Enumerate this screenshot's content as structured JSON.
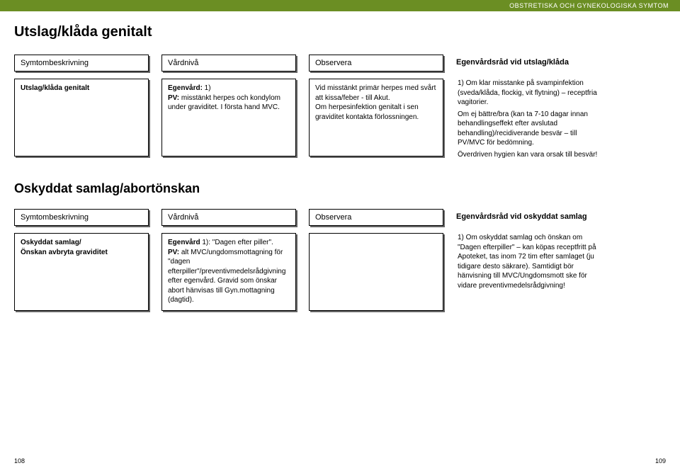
{
  "banner": "OBSTRETISKA OCH GYNEKOLOGISKA SYMTOM",
  "mainTitle": "Utslag/klåda genitalt",
  "section1": {
    "headers": {
      "c1": "Symtombeskrivning",
      "c2": "Vårdnivå",
      "c3": "Observera",
      "c4": "Egenvårdsråd vid utslag/klåda"
    },
    "row": {
      "c1_bold": "Utslag/klåda genitalt",
      "c2_b1": "Egenvård:",
      "c2_t1": " 1)",
      "c2_b2": "PV:",
      "c2_t2": " misstänkt herpes och kondylom under graviditet. I första hand MVC.",
      "c3": "Vid misstänkt primär herpes med svårt att kissa/feber - till Akut.\nOm herpesinfektion genitalt i sen graviditet kontakta förlossningen.",
      "c4_p1": "1) Om klar misstanke på svampinfektion (sveda/klåda, flockig, vit flytning) – receptfria vagitorier.",
      "c4_p2": "Om ej bättre/bra (kan ta 7-10 dagar innan behandlingseffekt efter avslutad behandling)/recidiverande besvär – till PV/MVC för bedömning.",
      "c4_p3": "Överdriven hygien kan vara orsak till besvär!"
    }
  },
  "subTitle": "Oskyddat samlag/abortönskan",
  "section2": {
    "headers": {
      "c1": "Symtombeskrivning",
      "c2": "Vårdnivå",
      "c3": "Observera",
      "c4": "Egenvårdsråd vid oskyddat samlag"
    },
    "row": {
      "c1_l1": "Oskyddat samlag/",
      "c1_l2": "Önskan avbryta graviditet",
      "c2_b1": "Egenvård",
      "c2_t1": " 1): \"Dagen efter piller\".",
      "c2_b2": "PV:",
      "c2_t2": " alt MVC/ungdomsmottagning för \"dagen efterpiller\"/preventivmedelsrådgivning efter egenvård. Gravid som önskar abort hänvisas till Gyn.mottagning (dagtid).",
      "c4": "1) Om oskyddat samlag och önskan om \"Dagen efterpiller\" – kan köpas receptfritt på Apoteket, tas inom 72 tim efter samlaget (ju tidigare desto säkrare). Samtidigt bör hänvisning till MVC/Ungdomsmott ske för vidare preventivmedelsrådgivning!"
    }
  },
  "pageLeft": "108",
  "pageRight": "109"
}
